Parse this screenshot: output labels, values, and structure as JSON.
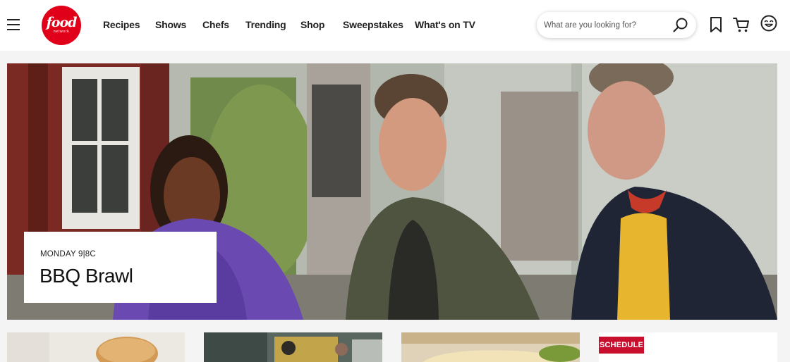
{
  "brand": {
    "logo_text": "food",
    "logo_subtext": "network",
    "color": "#e1001a"
  },
  "nav": {
    "items": [
      {
        "label": "Recipes"
      },
      {
        "label": "Shows"
      },
      {
        "label": "Chefs"
      },
      {
        "label": "Trending"
      },
      {
        "label": "Shop"
      },
      {
        "label": "Sweepstakes"
      },
      {
        "label": "What's on TV"
      }
    ]
  },
  "search": {
    "placeholder": "What are you looking for?",
    "value": ""
  },
  "header_icons": [
    "menu-icon",
    "search-icon",
    "bookmark-icon",
    "cart-icon",
    "user-icon"
  ],
  "hero": {
    "meta": "MONDAY 9|8C",
    "title": "BBQ Brawl"
  },
  "cards": {
    "schedule_badge": "SCHEDULE",
    "badge_color": "#c8102e"
  }
}
